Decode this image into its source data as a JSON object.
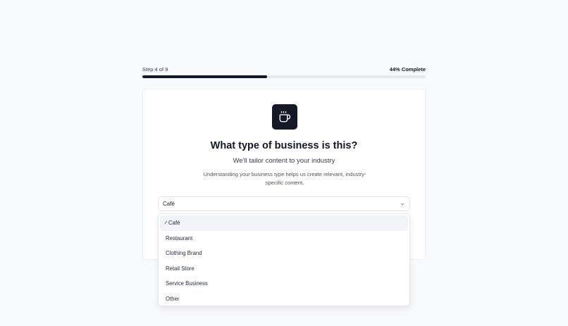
{
  "progress": {
    "step_label": "Step 4 of 9",
    "percent_label": "44% Complete",
    "fraction": 0.44
  },
  "card": {
    "icon": "coffee-cup-icon",
    "title": "What type of business is this?",
    "subtitle": "We'll tailor content to your industry",
    "description": "Understanding your business type helps us create relevant, industry-specific content."
  },
  "select": {
    "value": "Café",
    "options": [
      {
        "label": "Café",
        "selected": true
      },
      {
        "label": "Restaurant",
        "selected": false
      },
      {
        "label": "Clothing Brand",
        "selected": false
      },
      {
        "label": "Retail Store",
        "selected": false
      },
      {
        "label": "Service Business",
        "selected": false
      },
      {
        "label": "Other",
        "selected": false
      }
    ],
    "check_glyph": "✓"
  },
  "colors": {
    "accent": "#111827",
    "track": "#e5e7eb",
    "selected_bg": "#f1f3f6"
  }
}
